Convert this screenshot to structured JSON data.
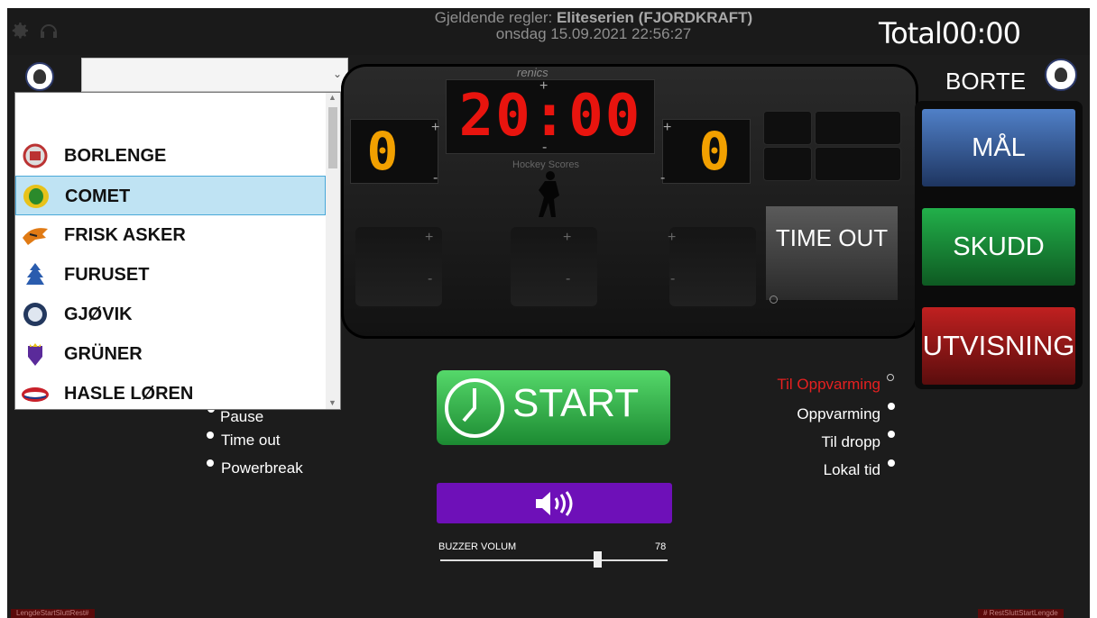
{
  "header": {
    "rules_label": "Gjeldende regler:",
    "rules_value": "Eliteserien (FJORDKRAFT)",
    "datetime": "onsdag  15.09.2021  22:56:27",
    "total_label": "Total",
    "total_time": "00:00"
  },
  "away": {
    "label": "BORTE"
  },
  "scoreboard": {
    "brand": "renics",
    "clock": "20:00",
    "subtitle": "Hockey Scores",
    "home_score": "0",
    "away_score": "0",
    "plus": "+",
    "minus": "-"
  },
  "buttons": {
    "timeout": "TIME OUT",
    "goal": "MÅL",
    "shot": "SKUDD",
    "penalty": "UTVISNING",
    "start": "START"
  },
  "buzzer": {
    "label": "BUZZER VOLUM",
    "value": 78
  },
  "left_options": [
    "Pause",
    "Time out",
    "Powerbreak"
  ],
  "right_options": [
    "Til Oppvarming",
    "Oppvarming",
    "Til dropp",
    "Lokal tid"
  ],
  "footer": {
    "left_tag": "LengdeStartSluttRest#",
    "right_tag": "#  RestSluttStartLengde"
  },
  "dropdown": {
    "selected": "COMET",
    "items": [
      "BORLENGE",
      "COMET",
      "FRISK ASKER",
      "FURUSET",
      "GJØVIK",
      "GRÜNER",
      "HASLE LØREN"
    ]
  },
  "colors": {
    "goal": "#3a66ad",
    "shot": "#1a9a3c",
    "penalty": "#9a1414",
    "clock": "#e8140e",
    "score": "#f2a000",
    "buzzer": "#6e10b8"
  }
}
